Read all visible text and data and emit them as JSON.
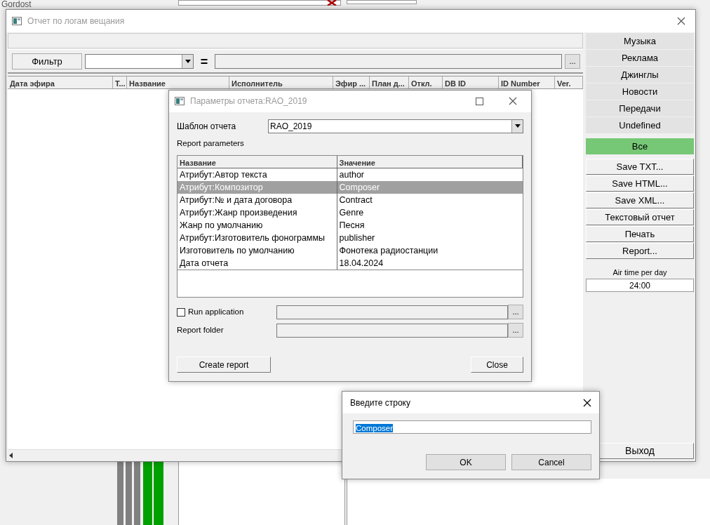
{
  "background_app": {
    "logo_text": "Gordost"
  },
  "main_window": {
    "title": "Отчет по логам вещания",
    "filter": {
      "button": "Фильтр",
      "operator": "=",
      "browse": "..."
    },
    "table": {
      "columns": [
        "Дата эфира",
        "Т...",
        "Название",
        "Исполнитель",
        "Эфир ...",
        "План д...",
        "Откл.",
        "DB ID",
        "ID Number",
        "Ver."
      ]
    },
    "categories": [
      {
        "label": "Музыка",
        "selected": false
      },
      {
        "label": "Реклама",
        "selected": false
      },
      {
        "label": "Джинглы",
        "selected": false
      },
      {
        "label": "Новости",
        "selected": false
      },
      {
        "label": "Передачи",
        "selected": false
      },
      {
        "label": "Undefined",
        "selected": false
      },
      {
        "label": "Все",
        "selected": true
      }
    ],
    "actions": [
      "Save TXT...",
      "Save HTML...",
      "Save XML...",
      "Текстовый отчет",
      "Печать",
      "Report..."
    ],
    "air_time": {
      "label": "Air time per day",
      "value": "24:00"
    },
    "exit_button": "Выход"
  },
  "params_dialog": {
    "title": "Параметры отчета:RAO_2019",
    "template_label": "Шаблон отчета",
    "template_value": "RAO_2019",
    "section_label": "Report parameters",
    "columns": [
      "Название",
      "Значение"
    ],
    "rows": [
      {
        "name": "Атрибут:Автор текста",
        "value": "author",
        "selected": false
      },
      {
        "name": "Атрибут:Композитор",
        "value": "Composer",
        "selected": true
      },
      {
        "name": "Атрибут:№ и дата договора",
        "value": "Contract",
        "selected": false
      },
      {
        "name": "Атрибут:Жанр произведения",
        "value": "Genre",
        "selected": false
      },
      {
        "name": "Жанр  по умолчанию",
        "value": "Песня",
        "selected": false
      },
      {
        "name": "Атрибут:Изготовитель фонограммы",
        "value": "publisher",
        "selected": false
      },
      {
        "name": "Изготовитель по умолчанию",
        "value": "Фонотека радиостанции",
        "selected": false
      },
      {
        "name": "Дата отчета",
        "value": "18.04.2024",
        "selected": false
      }
    ],
    "run_application": {
      "label": "Run application",
      "checked": false,
      "browse": "..."
    },
    "report_folder": {
      "label": "Report folder",
      "browse": "..."
    },
    "buttons": [
      "Create report",
      "Close"
    ]
  },
  "input_dialog": {
    "title": "Введите строку",
    "value": "Composer",
    "value_selected": true,
    "buttons": [
      "OK",
      "Cancel"
    ]
  }
}
